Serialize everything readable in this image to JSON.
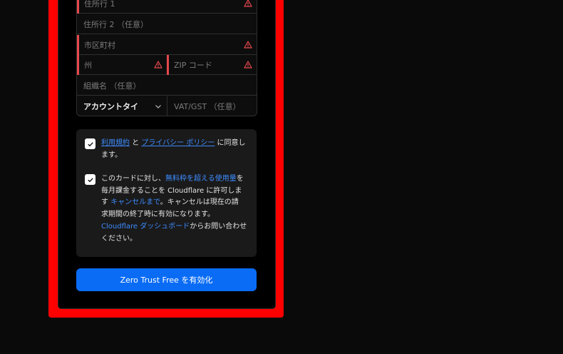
{
  "form": {
    "address1_label": "住所行 1",
    "address2_label": "住所行 2 （任意）",
    "city_label": "市区町村",
    "state_label": "州",
    "zip_label": "ZIP コード",
    "org_label": "組織名 （任意）",
    "account_type_value": "アカウントタイ",
    "vat_label": "VAT/GST （任意）"
  },
  "consent": {
    "terms": {
      "link1": "利用規約",
      "and": " と ",
      "link2": "プライバシー ポリシー",
      "rest1": " に同意し",
      "rest2": "ます。"
    },
    "billing": {
      "p1": "このカードに対し、",
      "link_free": "無料枠を超える使用量",
      "p2": "を",
      "line2": "毎月課金することを Cloudflare に許可しま",
      "p3": "す ",
      "link_cancel": "キャンセルまで",
      "p4": "。キャンセルは現在の請",
      "line4": "求期間の終了時に有効になります。",
      "link_dash": "Cloudflare ダッシュボード",
      "p5": "からお問い合わせ",
      "line6": "ください。"
    }
  },
  "cta_label": "Zero Trust Free を有効化",
  "colors": {
    "accent": "#0a6cf5",
    "link": "#3d8bff",
    "error": "#e5484d",
    "highlight": "#ff0000"
  }
}
